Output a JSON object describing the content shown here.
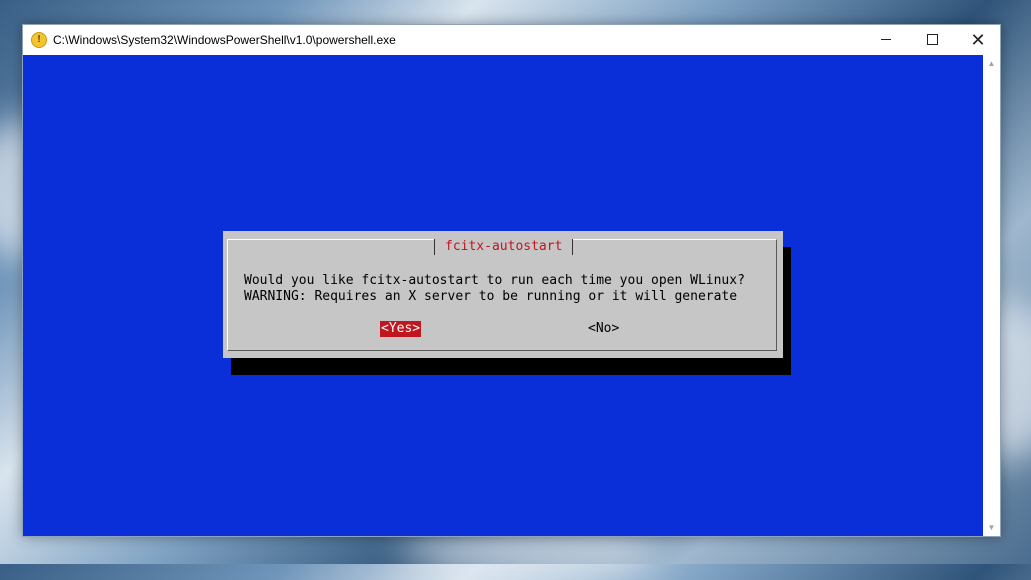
{
  "window": {
    "title": "C:\\Windows\\System32\\WindowsPowerShell\\v1.0\\powershell.exe",
    "icon": "powershell-warning-icon",
    "controls": {
      "minimize": "minimize",
      "maximize": "maximize",
      "close": "close"
    }
  },
  "dialog": {
    "title": "fcitx-autostart",
    "message_line1": "Would you like fcitx-autostart to run each time you open WLinux?",
    "message_line2": "WARNING: Requires an X server to be running or it will generate",
    "yes_label": "<Yes>",
    "no_label": "<No>"
  },
  "colors": {
    "console_bg": "#0a2ed8",
    "dialog_bg": "#c6c6c6",
    "accent_red": "#c0161f"
  }
}
